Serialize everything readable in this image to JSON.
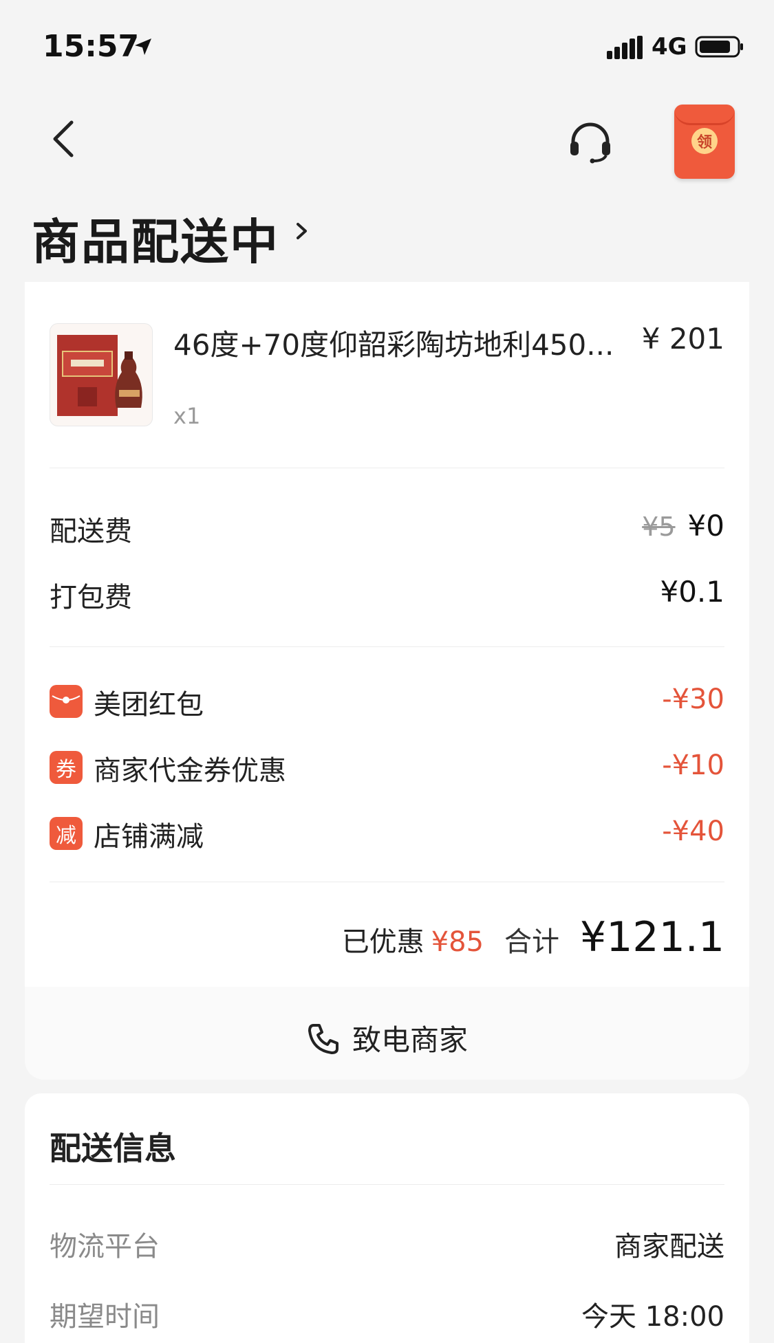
{
  "status_bar": {
    "time": "15:57",
    "network": "4G"
  },
  "header": {
    "title": "商品配送中",
    "redpacket_label": "领"
  },
  "order": {
    "product": {
      "name": "46度+70度仰韶彩陶坊地利450...",
      "price": "¥ 201",
      "quantity": "x1"
    },
    "fees": [
      {
        "label": "配送费",
        "original": "¥5",
        "value": "¥0"
      },
      {
        "label": "打包费",
        "original": "",
        "value": "¥0.1"
      }
    ],
    "discounts": [
      {
        "icon": "red-packet-icon",
        "icon_text": "",
        "label": "美团红包",
        "value": "-¥30"
      },
      {
        "icon": "coupon-icon",
        "icon_text": "券",
        "label": "商家代金券优惠",
        "value": "-¥10"
      },
      {
        "icon": "discount-icon",
        "icon_text": "减",
        "label": "店铺满减",
        "value": "-¥40"
      }
    ],
    "summary": {
      "saved_label": "已优惠",
      "saved_value": "¥85",
      "total_label": "合计",
      "total_value": "¥121.1"
    },
    "call_merchant": "致电商家"
  },
  "delivery": {
    "title": "配送信息",
    "rows": [
      {
        "label": "物流平台",
        "value": "商家配送"
      },
      {
        "label": "期望时间",
        "value": "今天 18:00"
      }
    ]
  },
  "colors": {
    "accent": "#ef5a3c",
    "discount_text": "#e4543a",
    "background": "#f4f4f4"
  }
}
